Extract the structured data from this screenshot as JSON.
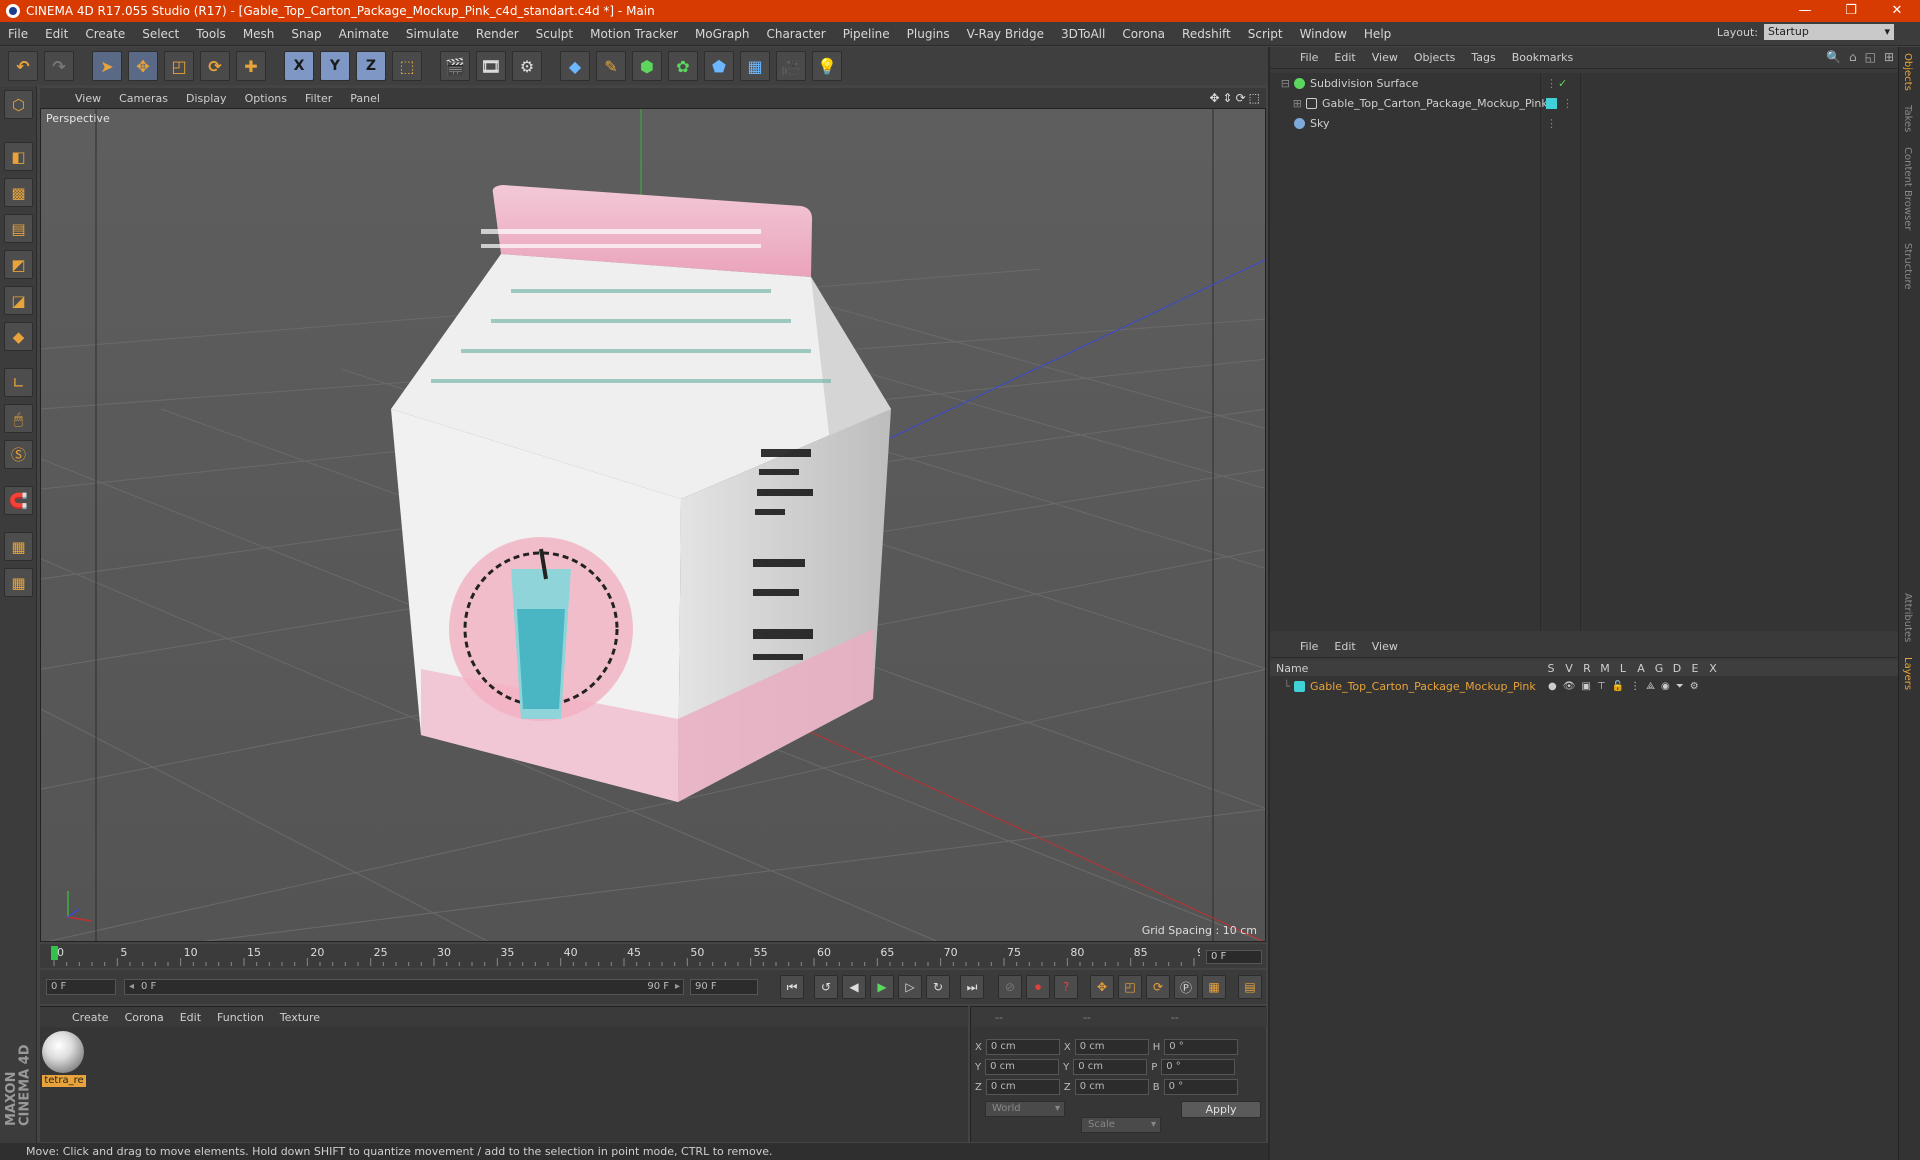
{
  "window": {
    "title": "CINEMA 4D R17.055 Studio (R17) - [Gable_Top_Carton_Package_Mockup_Pink_c4d_standart.c4d *] - Main",
    "buttons": [
      "—",
      "❐",
      "✕"
    ]
  },
  "menubar": {
    "items": [
      "File",
      "Edit",
      "Create",
      "Select",
      "Tools",
      "Mesh",
      "Snap",
      "Animate",
      "Simulate",
      "Render",
      "Sculpt",
      "Motion Tracker",
      "MoGraph",
      "Character",
      "Pipeline",
      "Plugins",
      "V-Ray Bridge",
      "3DToAll",
      "Corona",
      "Redshift",
      "Script",
      "Window",
      "Help"
    ],
    "layout_label": "Layout:",
    "layout_value": "Startup"
  },
  "toolbar": {
    "axis_labels": [
      "X",
      "Y",
      "Z"
    ]
  },
  "viewport": {
    "menu": [
      "View",
      "Cameras",
      "Display",
      "Options",
      "Filter",
      "Panel"
    ],
    "label": "Perspective",
    "grid_spacing": "Grid Spacing : 10 cm"
  },
  "timeline": {
    "ticks": [
      "0",
      "5",
      "10",
      "15",
      "20",
      "25",
      "30",
      "35",
      "40",
      "45",
      "50",
      "55",
      "60",
      "65",
      "70",
      "75",
      "80",
      "85",
      "90"
    ],
    "current_frame": "0 F",
    "max_frame": 90
  },
  "transport": {
    "start_field": "0 F",
    "range_left": "0 F",
    "range_right": "90 F",
    "end_field": "90 F"
  },
  "material_panel": {
    "menu": [
      "Create",
      "Corona",
      "Edit",
      "Function",
      "Texture"
    ],
    "material_name": "tetra_re"
  },
  "coordinates": {
    "headers": [
      "--",
      "--",
      "--"
    ],
    "rows": [
      {
        "a": "X",
        "av": "0 cm",
        "b": "X",
        "bv": "0 cm",
        "c": "H",
        "cv": "0 °"
      },
      {
        "a": "Y",
        "av": "0 cm",
        "b": "Y",
        "bv": "0 cm",
        "c": "P",
        "cv": "0 °"
      },
      {
        "a": "Z",
        "av": "0 cm",
        "b": "Z",
        "bv": "0 cm",
        "c": "B",
        "cv": "0 °"
      }
    ],
    "mode1": "World",
    "mode2": "Scale",
    "apply": "Apply"
  },
  "object_manager": {
    "menu": [
      "File",
      "Edit",
      "View",
      "Objects",
      "Tags",
      "Bookmarks"
    ],
    "objects": [
      {
        "name": "Subdivision Surface"
      },
      {
        "name": "Gable_Top_Carton_Package_Mockup_Pink"
      },
      {
        "name": "Sky"
      }
    ]
  },
  "layer_manager": {
    "menu": [
      "File",
      "Edit",
      "View"
    ],
    "name_header": "Name",
    "flag_headers": [
      "S",
      "V",
      "R",
      "M",
      "L",
      "A",
      "G",
      "D",
      "E",
      "X"
    ],
    "layers": [
      {
        "name": "Gable_Top_Carton_Package_Mockup_Pink"
      }
    ]
  },
  "right_tabs": [
    "Objects",
    "Takes",
    "Content Browser",
    "Structure",
    "Attributes",
    "Layers"
  ],
  "status": "Move: Click and drag to move elements. Hold down SHIFT to quantize movement / add to the selection in point mode, CTRL to remove.",
  "colors": {
    "title_bar": "#d83b01",
    "accent": "#e8a33a",
    "layer_color": "#3fd0d8"
  }
}
